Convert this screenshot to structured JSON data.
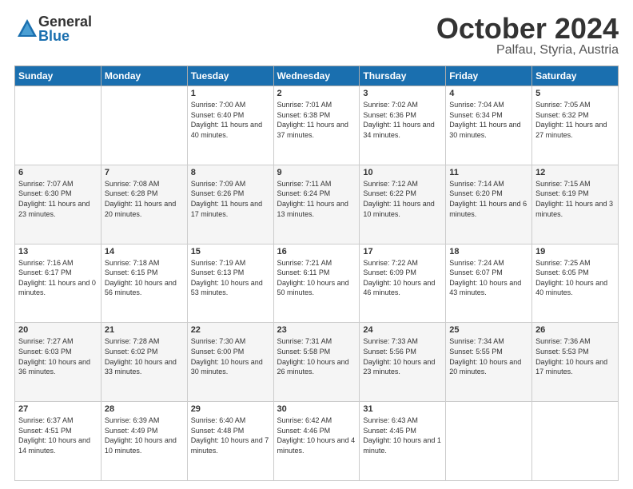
{
  "header": {
    "logo_general": "General",
    "logo_blue": "Blue",
    "month_title": "October 2024",
    "location": "Palfau, Styria, Austria"
  },
  "weekdays": [
    "Sunday",
    "Monday",
    "Tuesday",
    "Wednesday",
    "Thursday",
    "Friday",
    "Saturday"
  ],
  "weeks": [
    [
      {
        "day": "",
        "info": ""
      },
      {
        "day": "",
        "info": ""
      },
      {
        "day": "1",
        "info": "Sunrise: 7:00 AM\nSunset: 6:40 PM\nDaylight: 11 hours and 40 minutes."
      },
      {
        "day": "2",
        "info": "Sunrise: 7:01 AM\nSunset: 6:38 PM\nDaylight: 11 hours and 37 minutes."
      },
      {
        "day": "3",
        "info": "Sunrise: 7:02 AM\nSunset: 6:36 PM\nDaylight: 11 hours and 34 minutes."
      },
      {
        "day": "4",
        "info": "Sunrise: 7:04 AM\nSunset: 6:34 PM\nDaylight: 11 hours and 30 minutes."
      },
      {
        "day": "5",
        "info": "Sunrise: 7:05 AM\nSunset: 6:32 PM\nDaylight: 11 hours and 27 minutes."
      }
    ],
    [
      {
        "day": "6",
        "info": "Sunrise: 7:07 AM\nSunset: 6:30 PM\nDaylight: 11 hours and 23 minutes."
      },
      {
        "day": "7",
        "info": "Sunrise: 7:08 AM\nSunset: 6:28 PM\nDaylight: 11 hours and 20 minutes."
      },
      {
        "day": "8",
        "info": "Sunrise: 7:09 AM\nSunset: 6:26 PM\nDaylight: 11 hours and 17 minutes."
      },
      {
        "day": "9",
        "info": "Sunrise: 7:11 AM\nSunset: 6:24 PM\nDaylight: 11 hours and 13 minutes."
      },
      {
        "day": "10",
        "info": "Sunrise: 7:12 AM\nSunset: 6:22 PM\nDaylight: 11 hours and 10 minutes."
      },
      {
        "day": "11",
        "info": "Sunrise: 7:14 AM\nSunset: 6:20 PM\nDaylight: 11 hours and 6 minutes."
      },
      {
        "day": "12",
        "info": "Sunrise: 7:15 AM\nSunset: 6:19 PM\nDaylight: 11 hours and 3 minutes."
      }
    ],
    [
      {
        "day": "13",
        "info": "Sunrise: 7:16 AM\nSunset: 6:17 PM\nDaylight: 11 hours and 0 minutes."
      },
      {
        "day": "14",
        "info": "Sunrise: 7:18 AM\nSunset: 6:15 PM\nDaylight: 10 hours and 56 minutes."
      },
      {
        "day": "15",
        "info": "Sunrise: 7:19 AM\nSunset: 6:13 PM\nDaylight: 10 hours and 53 minutes."
      },
      {
        "day": "16",
        "info": "Sunrise: 7:21 AM\nSunset: 6:11 PM\nDaylight: 10 hours and 50 minutes."
      },
      {
        "day": "17",
        "info": "Sunrise: 7:22 AM\nSunset: 6:09 PM\nDaylight: 10 hours and 46 minutes."
      },
      {
        "day": "18",
        "info": "Sunrise: 7:24 AM\nSunset: 6:07 PM\nDaylight: 10 hours and 43 minutes."
      },
      {
        "day": "19",
        "info": "Sunrise: 7:25 AM\nSunset: 6:05 PM\nDaylight: 10 hours and 40 minutes."
      }
    ],
    [
      {
        "day": "20",
        "info": "Sunrise: 7:27 AM\nSunset: 6:03 PM\nDaylight: 10 hours and 36 minutes."
      },
      {
        "day": "21",
        "info": "Sunrise: 7:28 AM\nSunset: 6:02 PM\nDaylight: 10 hours and 33 minutes."
      },
      {
        "day": "22",
        "info": "Sunrise: 7:30 AM\nSunset: 6:00 PM\nDaylight: 10 hours and 30 minutes."
      },
      {
        "day": "23",
        "info": "Sunrise: 7:31 AM\nSunset: 5:58 PM\nDaylight: 10 hours and 26 minutes."
      },
      {
        "day": "24",
        "info": "Sunrise: 7:33 AM\nSunset: 5:56 PM\nDaylight: 10 hours and 23 minutes."
      },
      {
        "day": "25",
        "info": "Sunrise: 7:34 AM\nSunset: 5:55 PM\nDaylight: 10 hours and 20 minutes."
      },
      {
        "day": "26",
        "info": "Sunrise: 7:36 AM\nSunset: 5:53 PM\nDaylight: 10 hours and 17 minutes."
      }
    ],
    [
      {
        "day": "27",
        "info": "Sunrise: 6:37 AM\nSunset: 4:51 PM\nDaylight: 10 hours and 14 minutes."
      },
      {
        "day": "28",
        "info": "Sunrise: 6:39 AM\nSunset: 4:49 PM\nDaylight: 10 hours and 10 minutes."
      },
      {
        "day": "29",
        "info": "Sunrise: 6:40 AM\nSunset: 4:48 PM\nDaylight: 10 hours and 7 minutes."
      },
      {
        "day": "30",
        "info": "Sunrise: 6:42 AM\nSunset: 4:46 PM\nDaylight: 10 hours and 4 minutes."
      },
      {
        "day": "31",
        "info": "Sunrise: 6:43 AM\nSunset: 4:45 PM\nDaylight: 10 hours and 1 minute."
      },
      {
        "day": "",
        "info": ""
      },
      {
        "day": "",
        "info": ""
      }
    ]
  ]
}
